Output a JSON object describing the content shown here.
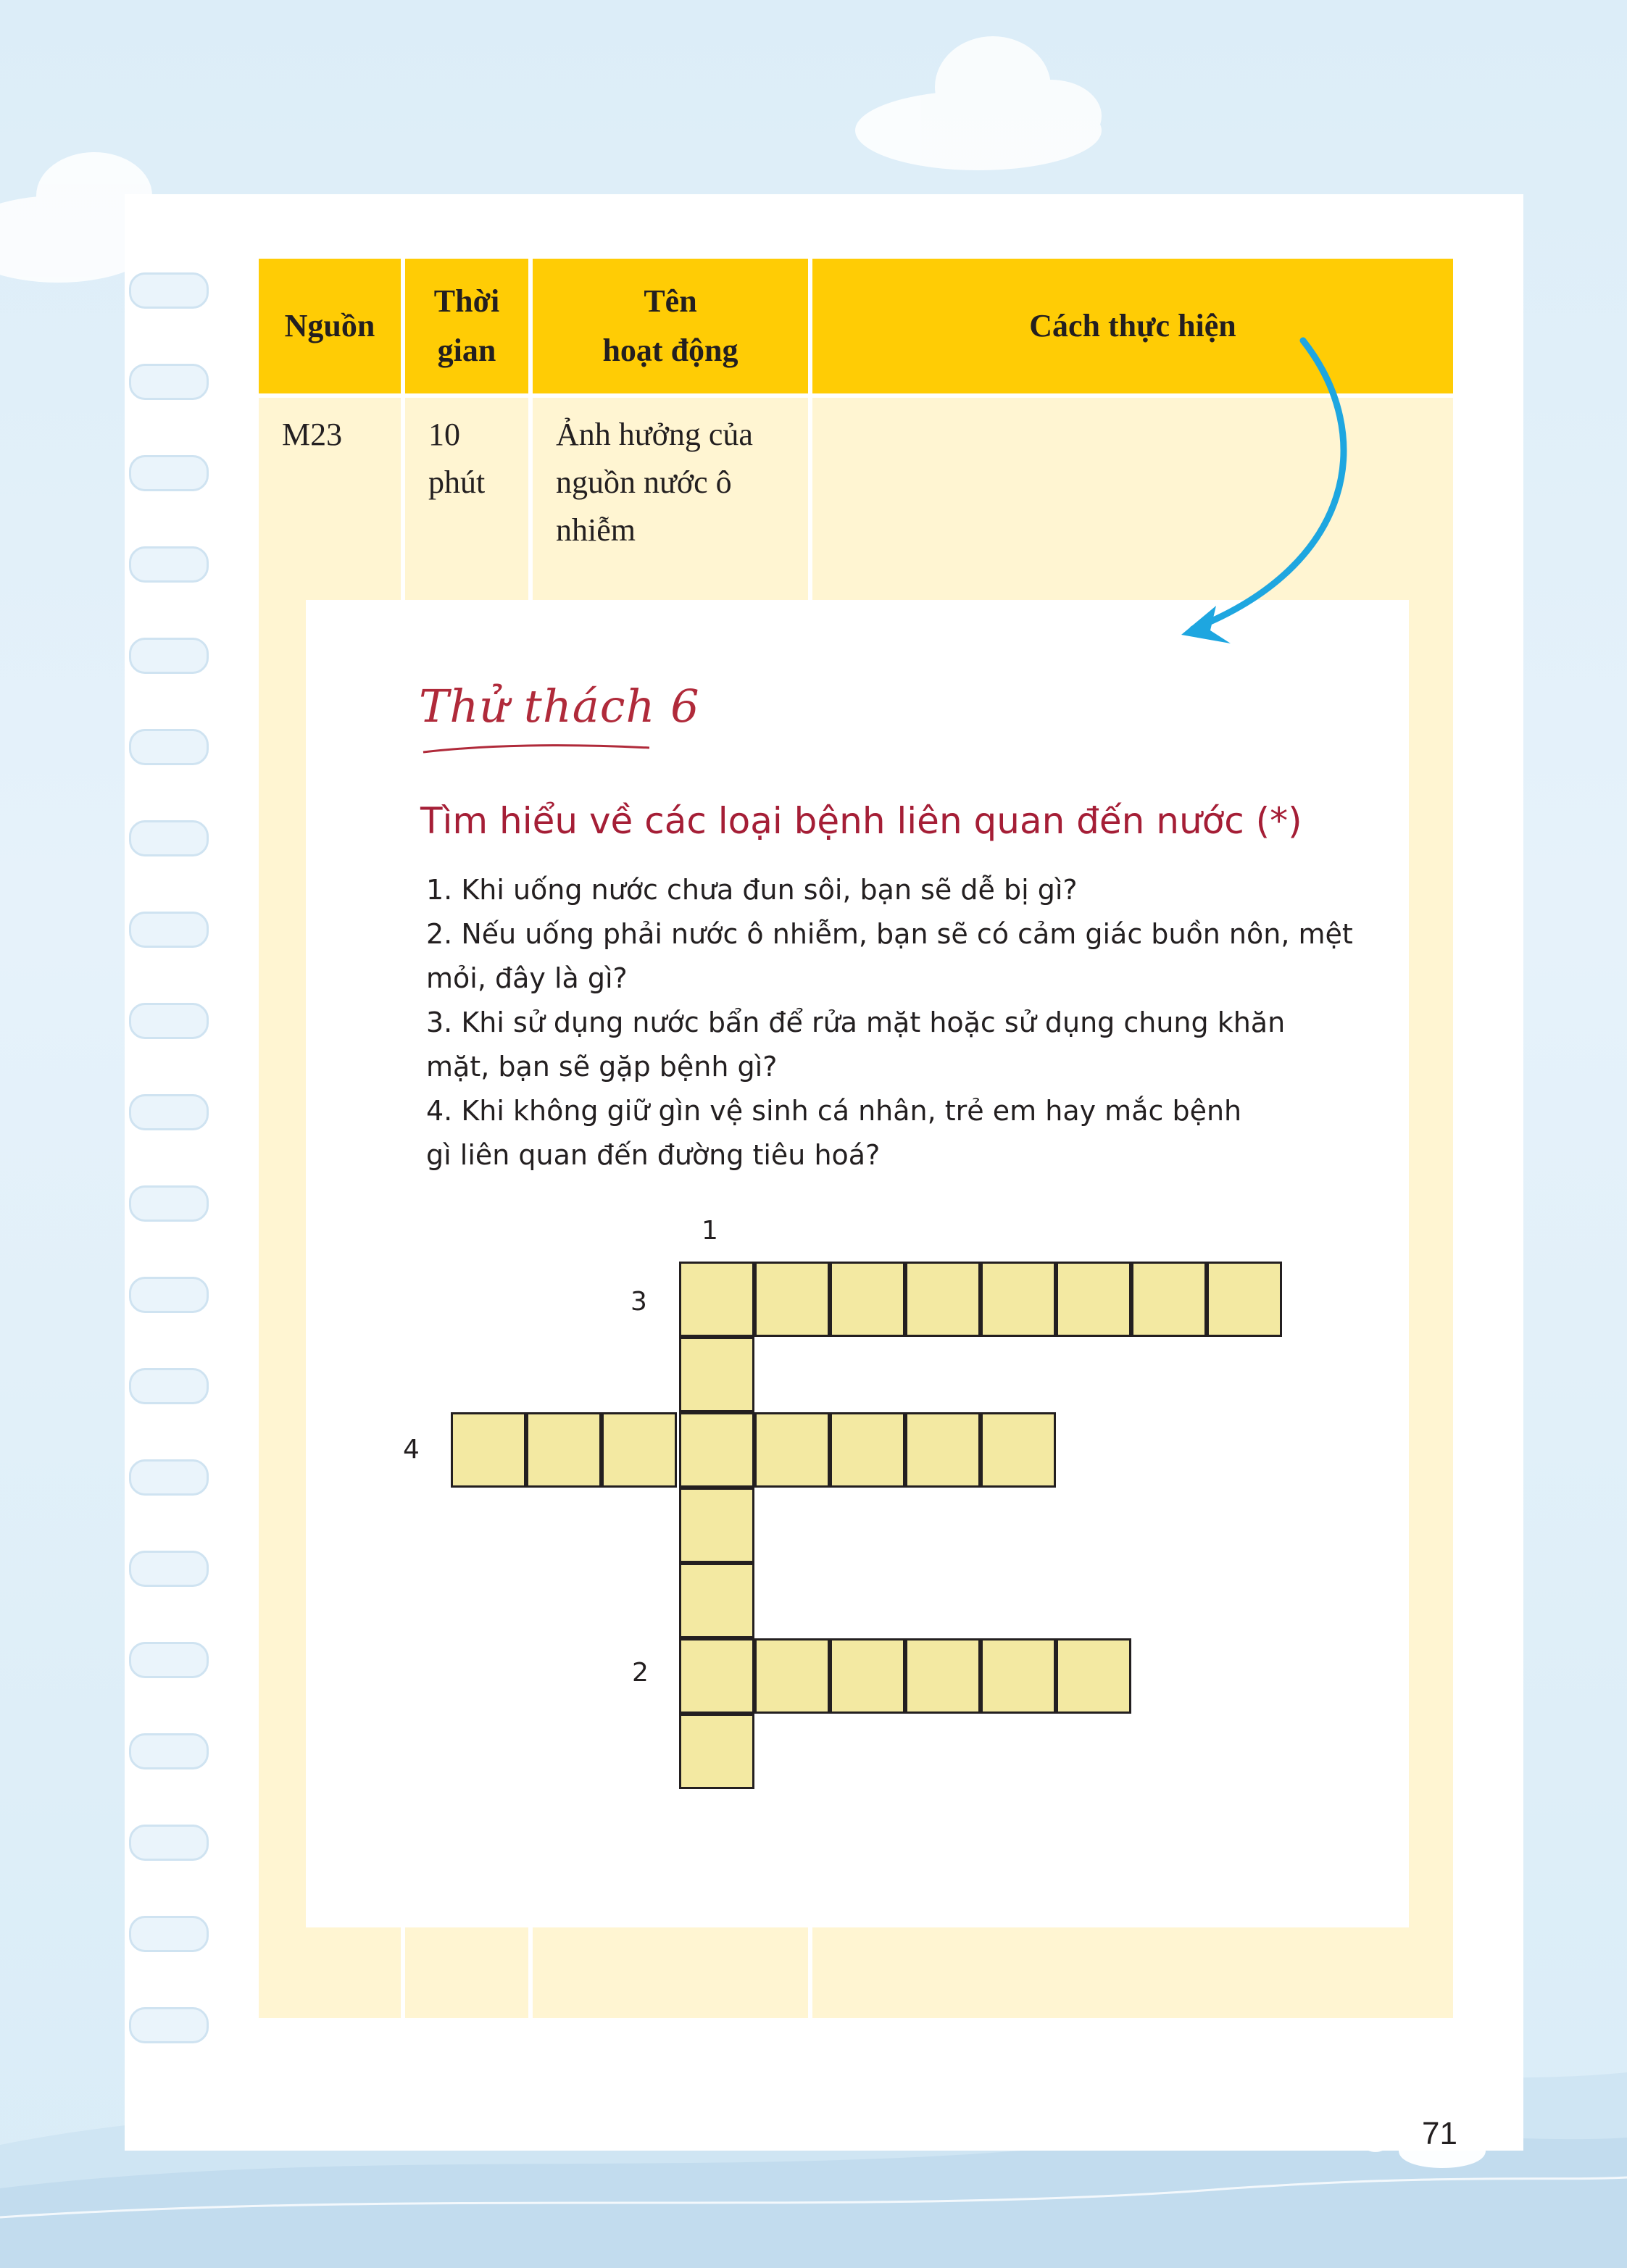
{
  "table": {
    "headers": [
      "Nguồn",
      "Thời\ngian",
      "Tên\nhoạt động",
      "Cách thực hiện"
    ],
    "row": {
      "source": "M23",
      "time": "10\nphút",
      "activity": "Ảnh hưởng của\nnguồn nước ô\nnhiễm"
    }
  },
  "challenge": {
    "title": "Thử thách 6",
    "subtitle": "Tìm hiểu về các loại bệnh liên quan đến nước (*)",
    "questions": [
      "1. Khi uống nước chưa đun sôi, bạn sẽ dễ bị gì?",
      "2. Nếu uống phải nước ô nhiễm, bạn sẽ có cảm giác buồn nôn, mệt mỏi, đây là gì?",
      "3. Khi sử dụng nước bẩn để rửa mặt hoặc sử dụng chung khăn mặt, bạn sẽ gặp bệnh gì?",
      "4. Khi không giữ gìn vệ sinh cá nhân, trẻ em hay mắc bệnh gì liên quan đến đường tiêu hoá?"
    ]
  },
  "crossword": {
    "clue_numbers": [
      "1",
      "3",
      "4",
      "2"
    ],
    "cell_color": "#f3e9a2",
    "words": [
      {
        "number": "1",
        "direction": "down",
        "length": 7
      },
      {
        "number": "3",
        "direction": "across",
        "length": 8
      },
      {
        "number": "4",
        "direction": "across",
        "length": 8
      },
      {
        "number": "2",
        "direction": "across",
        "length": 6
      }
    ]
  },
  "colors": {
    "header": "#ffcc05",
    "cell_bg": "#fff5d2",
    "accent_red": "#a51e36",
    "arrow": "#1ea6e0"
  },
  "page_number": "71"
}
